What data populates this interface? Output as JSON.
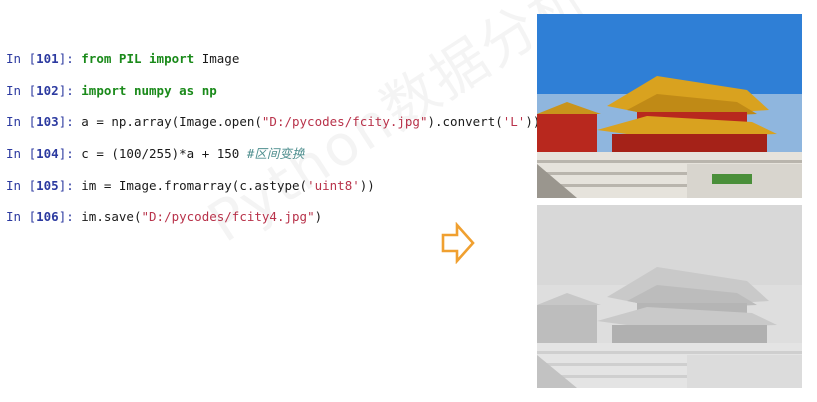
{
  "watermark": "Python数据分析与展示",
  "prompt_prefix": "In [",
  "prompt_suffix": "]:",
  "cells": [
    {
      "n": "101",
      "parts": [
        {
          "t": "from",
          "c": "kw"
        },
        {
          "t": " "
        },
        {
          "t": "PIL",
          "c": "kw"
        },
        {
          "t": " "
        },
        {
          "t": "import",
          "c": "kw"
        },
        {
          "t": " Image"
        }
      ]
    },
    {
      "n": "102",
      "parts": [
        {
          "t": "import",
          "c": "kw"
        },
        {
          "t": " "
        },
        {
          "t": "numpy",
          "c": "kw"
        },
        {
          "t": " "
        },
        {
          "t": "as",
          "c": "kw"
        },
        {
          "t": " "
        },
        {
          "t": "np",
          "c": "kw"
        }
      ]
    },
    {
      "n": "103",
      "parts": [
        {
          "t": "a = np.array(Image.open("
        },
        {
          "t": "\"D:/pycodes/fcity.jpg\"",
          "c": "str"
        },
        {
          "t": ").convert("
        },
        {
          "t": "'L'",
          "c": "str"
        },
        {
          "t": "))"
        }
      ]
    },
    {
      "n": "104",
      "parts": [
        {
          "t": "c = (100/255)*a + 150 "
        },
        {
          "t": "#区间变换",
          "c": "cm"
        }
      ]
    },
    {
      "n": "105",
      "parts": [
        {
          "t": "im = Image.fromarray(c.astype("
        },
        {
          "t": "'uint8'",
          "c": "str"
        },
        {
          "t": "))"
        }
      ]
    },
    {
      "n": "106",
      "parts": [
        {
          "t": "im.save("
        },
        {
          "t": "\"D:/pycodes/fcity4.jpg\"",
          "c": "str"
        },
        {
          "t": ")"
        }
      ]
    }
  ],
  "colors": {
    "arrow": "#f0a030",
    "sky": "#2f7fd6",
    "roof": "#d9a21f",
    "wall": "#b8281e",
    "stone": "#e6e3dc"
  }
}
